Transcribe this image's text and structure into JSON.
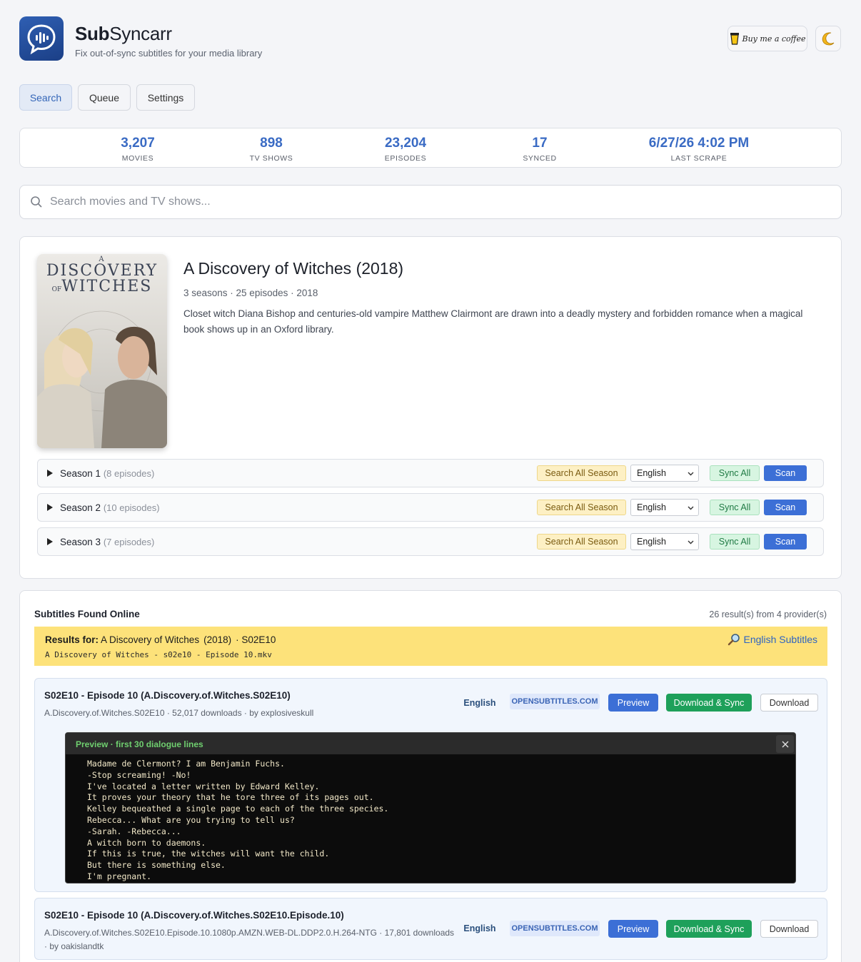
{
  "app": {
    "name_bold": "Sub",
    "name_rest": "Syncarr",
    "tagline": "Fix out-of-sync subtitles for your media library",
    "coffee_label": "Buy me a coffee",
    "theme_icon": "moon-icon"
  },
  "tabs": [
    {
      "label": "Search",
      "active": true
    },
    {
      "label": "Queue",
      "active": false
    },
    {
      "label": "Settings",
      "active": false
    }
  ],
  "stats": [
    {
      "value": "3,207",
      "label": "MOVIES"
    },
    {
      "value": "898",
      "label": "TV SHOWS"
    },
    {
      "value": "23,204",
      "label": "EPISODES"
    },
    {
      "value": "17",
      "label": "SYNCED"
    },
    {
      "value": "6/27/26 4:02 PM",
      "label": "LAST SCRAPE"
    }
  ],
  "search": {
    "placeholder": "Search movies and TV shows..."
  },
  "show": {
    "poster_a": "A",
    "poster_line1": "DISCOVERY",
    "poster_of": "OF",
    "poster_line2": "WITCHES",
    "title": "A Discovery of Witches (2018)",
    "meta": "3 seasons · 25 episodes · 2018",
    "description": "Closet witch Diana Bishop and centuries-old vampire Matthew Clairmont are drawn into a deadly mystery and forbidden romance when a magical book shows up in an Oxford library."
  },
  "seasons": [
    {
      "name": "Season 1",
      "count": "(8 episodes)"
    },
    {
      "name": "Season 2",
      "count": "(10 episodes)"
    },
    {
      "name": "Season 3",
      "count": "(7 episodes)"
    }
  ],
  "season_actions": {
    "search_all": "Search All Season",
    "language": "English",
    "sync_all": "Sync All",
    "scan": "Scan"
  },
  "results": {
    "title": "Subtitles Found Online",
    "count": "26 result(s) from 4 provider(s)",
    "banner": {
      "prefix": "Results for:",
      "show": "A Discovery of Witches",
      "year": "(2018)",
      "episode": "· S02E10",
      "filename": "A Discovery of Witches - s02e10 - Episode 10.mkv",
      "language_link": "English Subtitles"
    },
    "items": [
      {
        "title": "S02E10 - Episode 10 (A.Discovery.of.Witches.S02E10)",
        "subtitle": "A.Discovery.of.Witches.S02E10 · 52,017 downloads · by explosiveskull",
        "language": "English",
        "provider": "OPENSUBTITLES.COM"
      },
      {
        "title": "S02E10 - Episode 10 (A.Discovery.of.Witches.S02E10.Episode.10)",
        "subtitle": "A.Discovery.of.Witches.S02E10.Episode.10.1080p.AMZN.WEB-DL.DDP2.0.H.264-NTG · 17,801 downloads · by oakislandtk",
        "language": "English",
        "provider": "OPENSUBTITLES.COM"
      }
    ],
    "buttons": {
      "preview": "Preview",
      "download_sync": "Download & Sync",
      "download": "Download"
    },
    "preview": {
      "header": "Preview · first 30 dialogue lines",
      "lines": "Madame de Clermont? I am Benjamin Fuchs.\n-Stop screaming! -No!\nI've located a letter written by Edward Kelley.\nIt proves your theory that he tore three of its pages out.\nKelley bequeathed a single page to each of the three species.\nRebecca... What are you trying to tell us?\n-Sarah. -Rebecca...\nA witch born to daemons.\nIf this is true, the witches will want the child.\nBut there is something else.\nI'm pregnant."
    }
  },
  "colors": {
    "accent": "#3a6bc4",
    "banner": "#fde27a",
    "green": "#1ea05a",
    "blue": "#3c6fd6"
  }
}
